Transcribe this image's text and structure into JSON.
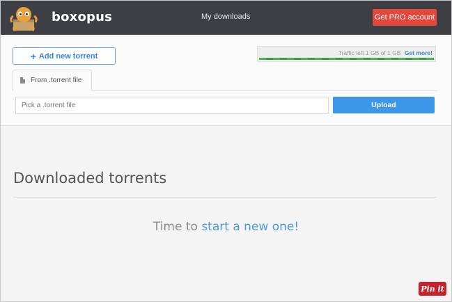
{
  "header": {
    "brand": "boxopus",
    "nav_link": "My downloads",
    "pro_button": "Get PRO account",
    "logo_icon": "octopus-logo-icon"
  },
  "upload": {
    "add_button_icon": "plus-icon",
    "add_button": "Add new torrent",
    "traffic_text": "Traffic left 1 GB of 1 GB",
    "traffic_link": "Get more!",
    "traffic_fraction": 1.0,
    "tab_icon": "file-icon",
    "tab_label": "From .torrent file",
    "file_placeholder": "Pick a .torrent file",
    "upload_button": "Upload"
  },
  "downloads": {
    "title": "Downloaded torrents",
    "empty_prefix": "Time to ",
    "empty_link": "start a new one!"
  },
  "pin": {
    "label": "Pin it"
  },
  "colors": {
    "navbar": "#3d3f44",
    "pro": "#e4473b",
    "accent": "#3d97e8",
    "traffic": "#4caf50",
    "pin": "#c8232c"
  }
}
